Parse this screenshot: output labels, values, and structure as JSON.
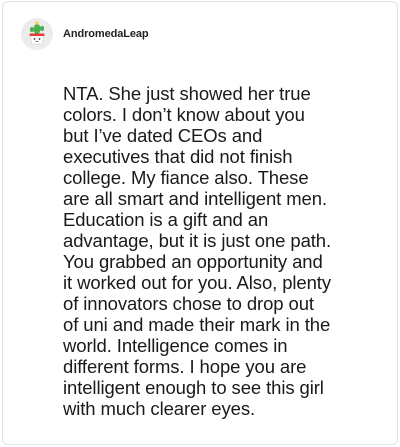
{
  "comment": {
    "author": {
      "username": "AndromedaLeap",
      "avatar_icon": "cactus-pot-avatar-icon"
    },
    "text": "NTA. She just showed her true\ncolors. I don’t know about you\nbut I’ve dated CEOs and\nexecutives that did not finish\ncollege. My fiance also. These\nare all smart and intelligent men.\nEducation is a gift and an\nadvantage, but it is just one path.\nYou grabbed an opportunity and\nit worked out for you. Also, plenty\nof innovators chose to drop out\nof uni and made their mark in the\nworld. Intelligence comes in\ndifferent forms. I hope you are\nintelligent enough to see this girl\nwith much clearer eyes."
  },
  "colors": {
    "card_border": "#e4e4e4",
    "avatar_background": "#ececec",
    "cactus_green": "#4caf50",
    "pot_red": "#e53935",
    "text": "#1a1a1a"
  }
}
